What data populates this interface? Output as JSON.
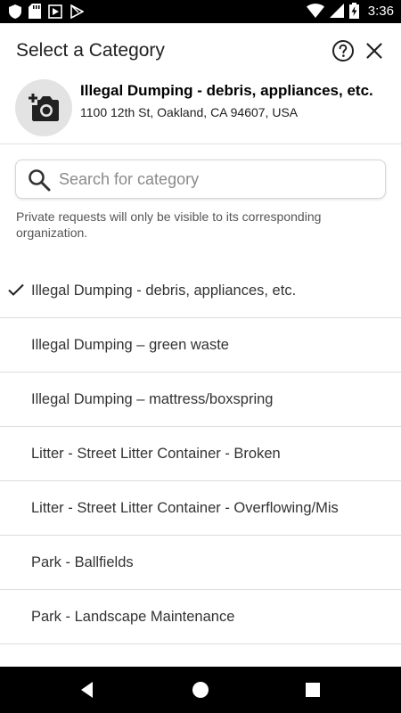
{
  "status_bar": {
    "time": "3:36",
    "left_icons": [
      "shield-icon",
      "sd-card-icon",
      "play-store-icon",
      "play-store-icon"
    ],
    "right_icons": [
      "wifi-icon",
      "signal-icon",
      "battery-charging-icon"
    ]
  },
  "header": {
    "title": "Select a Category",
    "help_icon": "help-circle-icon",
    "close_icon": "close-icon",
    "photo_icon": "add-photo-icon",
    "selected_category": "Illegal Dumping - debris, appliances, etc.",
    "address": "1100 12th St, Oakland, CA 94607, USA"
  },
  "search": {
    "placeholder": "Search for category",
    "value": ""
  },
  "private_note": "Private requests will only be visible to its corresponding organization.",
  "categories": [
    {
      "label": "Illegal Dumping - debris, appliances, etc.",
      "selected": true
    },
    {
      "label": "Illegal Dumping – green waste",
      "selected": false
    },
    {
      "label": "Illegal Dumping – mattress/boxspring",
      "selected": false
    },
    {
      "label": "Litter - Street Litter Container - Broken",
      "selected": false
    },
    {
      "label": "Litter - Street Litter Container - Overflowing/Mis",
      "selected": false
    },
    {
      "label": "Park - Ballfields",
      "selected": false
    },
    {
      "label": "Park - Landscape Maintenance",
      "selected": false
    }
  ],
  "nav_bar": {
    "icons": [
      "back-icon",
      "home-icon",
      "recents-icon"
    ]
  },
  "colors": {
    "status_bar_bg": "#000000",
    "nav_bar_bg": "#000000",
    "photo_circle_bg": "#e3e3e3",
    "divider": "#dcdcdc"
  }
}
